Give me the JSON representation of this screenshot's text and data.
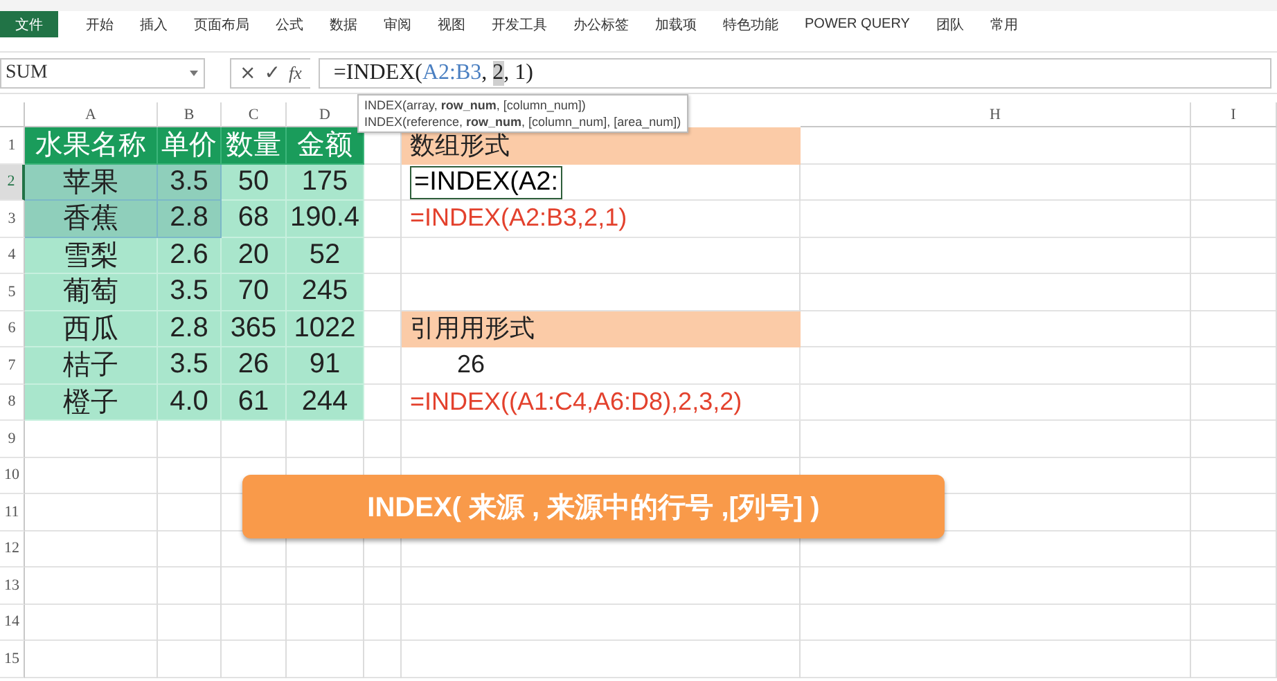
{
  "ribbon": {
    "file_tab": "文件",
    "tabs": [
      "开始",
      "插入",
      "页面布局",
      "公式",
      "数据",
      "审阅",
      "视图",
      "开发工具",
      "办公标签",
      "加载项",
      "特色功能",
      "POWER QUERY",
      "团队",
      "常用"
    ]
  },
  "formula_bar": {
    "name_box": "SUM",
    "cancel": "×",
    "enter": "✓",
    "function": "fx",
    "formula": [
      {
        "text": "=INDEX(",
        "kind": "plain"
      },
      {
        "text": "A2:B3",
        "kind": "reference"
      },
      {
        "text": ", ",
        "kind": "plain"
      },
      {
        "text": "2",
        "kind": "current"
      },
      {
        "text": ", 1)",
        "kind": "plain"
      }
    ]
  },
  "tooltip": [
    "INDEX(array, **row_num**, [column_num])",
    "INDEX(reference, **row_num**, [column_num], [area_num])"
  ],
  "sheet": {
    "column_headers": [
      "A",
      "B",
      "C",
      "D",
      "H",
      "I"
    ],
    "rows": [
      {
        "number": "1",
        "selected": false,
        "kind": "header",
        "cells": [
          {
            "text": "水果名称",
            "highlighted": false
          },
          {
            "text": "单价",
            "highlighted": false
          },
          {
            "text": "数量",
            "highlighted": false
          },
          {
            "text": "金额",
            "highlighted": false
          }
        ],
        "side": {
          "text": "数组形式",
          "kind": "heading"
        }
      },
      {
        "number": "2",
        "selected": true,
        "kind": "data",
        "cells": [
          {
            "text": "苹果",
            "highlighted": true
          },
          {
            "text": "3.5",
            "highlighted": true
          },
          {
            "text": "50",
            "highlighted": false
          },
          {
            "text": "175",
            "highlighted": false
          }
        ],
        "side": {
          "text": "=INDEX(A2:",
          "kind": "editing"
        }
      },
      {
        "number": "3",
        "selected": false,
        "kind": "data",
        "cells": [
          {
            "text": "香蕉",
            "highlighted": true
          },
          {
            "text": "2.8",
            "highlighted": true
          },
          {
            "text": "68",
            "highlighted": false
          },
          {
            "text": "190.4",
            "highlighted": false
          }
        ],
        "side": {
          "text": "=INDEX(A2:B3,2,1)",
          "kind": "formula"
        }
      },
      {
        "number": "4",
        "selected": false,
        "kind": "data",
        "cells": [
          {
            "text": "雪梨",
            "highlighted": false
          },
          {
            "text": "2.6",
            "highlighted": false
          },
          {
            "text": "20",
            "highlighted": false
          },
          {
            "text": "52",
            "highlighted": false
          }
        ]
      },
      {
        "number": "5",
        "selected": false,
        "kind": "data",
        "cells": [
          {
            "text": "葡萄",
            "highlighted": false
          },
          {
            "text": "3.5",
            "highlighted": false
          },
          {
            "text": "70",
            "highlighted": false
          },
          {
            "text": "245",
            "highlighted": false
          }
        ]
      },
      {
        "number": "6",
        "selected": false,
        "kind": "data",
        "cells": [
          {
            "text": "西瓜",
            "highlighted": false
          },
          {
            "text": "2.8",
            "highlighted": false
          },
          {
            "text": "365",
            "highlighted": false
          },
          {
            "text": "1022",
            "highlighted": false
          }
        ],
        "side": {
          "text": "引用用形式",
          "kind": "heading"
        }
      },
      {
        "number": "7",
        "selected": false,
        "kind": "data",
        "cells": [
          {
            "text": "桔子",
            "highlighted": false
          },
          {
            "text": "3.5",
            "highlighted": false
          },
          {
            "text": "26",
            "highlighted": false
          },
          {
            "text": "91",
            "highlighted": false
          }
        ],
        "side": {
          "text": "26",
          "kind": "value"
        }
      },
      {
        "number": "8",
        "selected": false,
        "kind": "data",
        "cells": [
          {
            "text": "橙子",
            "highlighted": false
          },
          {
            "text": "4.0",
            "highlighted": false
          },
          {
            "text": "61",
            "highlighted": false
          },
          {
            "text": "244",
            "highlighted": false
          }
        ],
        "side": {
          "text": "=INDEX((A1:C4,A6:D8),2,3,2)",
          "kind": "formula"
        }
      },
      {
        "number": "9",
        "selected": false,
        "kind": "empty"
      },
      {
        "number": "10",
        "selected": false,
        "kind": "empty"
      },
      {
        "number": "11",
        "selected": false,
        "kind": "empty"
      },
      {
        "number": "12",
        "selected": false,
        "kind": "empty"
      },
      {
        "number": "13",
        "selected": false,
        "kind": "empty"
      },
      {
        "number": "14",
        "selected": false,
        "kind": "empty"
      },
      {
        "number": "15",
        "selected": false,
        "kind": "empty"
      }
    ]
  },
  "banner": "INDEX( 来源 , 来源中的行号 ,[列号] )"
}
